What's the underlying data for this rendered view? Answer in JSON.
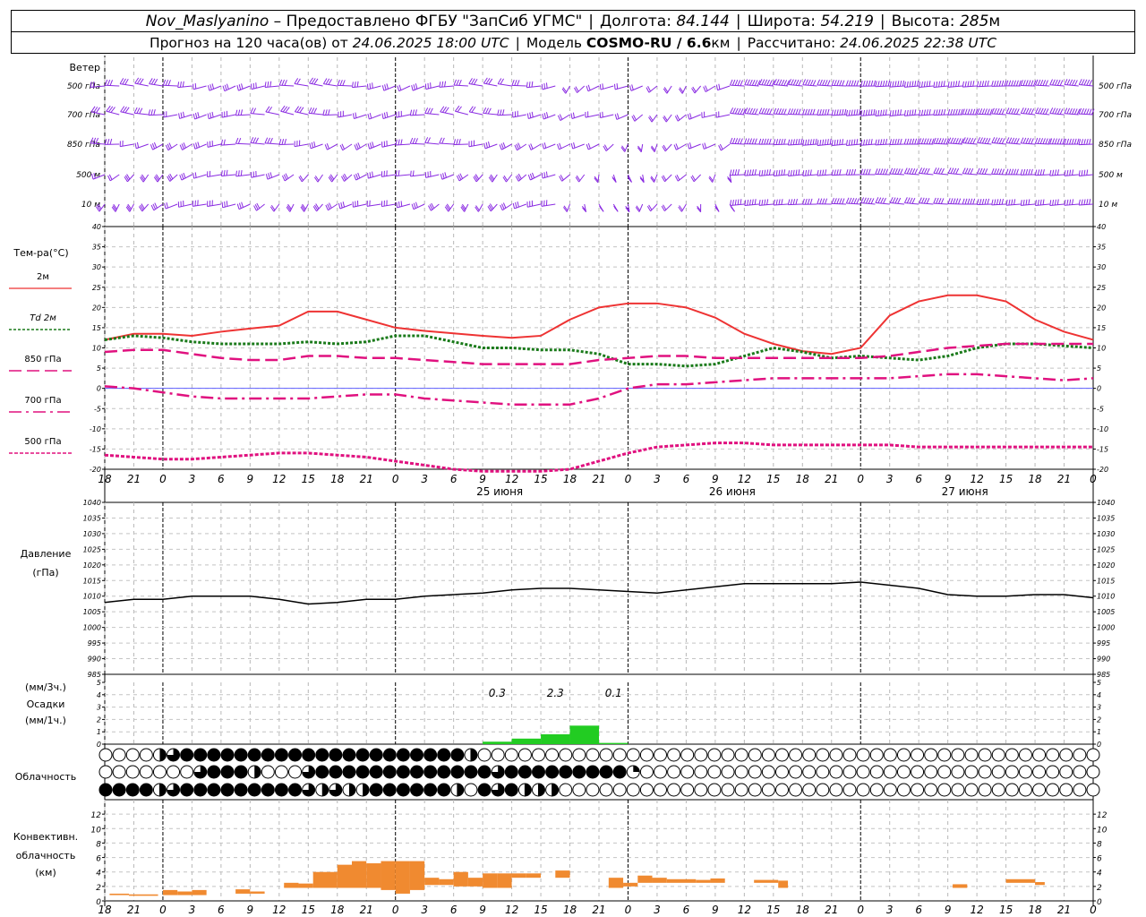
{
  "header": {
    "station": "Nov_Maslyanino",
    "provider": "– Предоставлено ФГБУ \"ЗапСиб УГМС\"",
    "sep": "|",
    "lon_label": "Долгота:",
    "lon_value": "84.144",
    "lat_label": "Широта:",
    "lat_value": "54.219",
    "alt_label": "Высота:",
    "alt_value": "285",
    "alt_unit": "м"
  },
  "subheader": {
    "forecast_label": "Прогноз на 120 часа(ов) от",
    "forecast_time": "24.06.2025 18:00 UTC",
    "model_label": "Модель",
    "model_name": "COSMO-RU / 6.6",
    "model_unit": "км",
    "calc_label": "Рассчитано:",
    "calc_time": "24.06.2025 22:38 UTC"
  },
  "colors": {
    "wind": "#8a2be2",
    "temp2m": "#ee3333",
    "td2m": "#1a7a1a",
    "t850": "#e0117f",
    "t700": "#e0117f",
    "t500": "#e0117f",
    "pressure": "#000000",
    "precip": "#22cc22",
    "conv": "#f08a30",
    "zero_line": "#6060ff"
  },
  "icons": {
    "wind": "wind-barb-icon",
    "cloud": "cloud-cover-circle-icon"
  },
  "time_axis": {
    "hour_labels": [
      "18",
      "21",
      "0",
      "3",
      "6",
      "9",
      "12",
      "15",
      "18",
      "21",
      "0",
      "3",
      "6",
      "9",
      "12",
      "15",
      "18",
      "21",
      "0",
      "3",
      "6",
      "9",
      "12",
      "15",
      "18",
      "21",
      "0",
      "3",
      "6",
      "9",
      "12",
      "15",
      "18",
      "21",
      "0"
    ],
    "date_labels": [
      {
        "label": "25 июня",
        "hour_index": 13
      },
      {
        "label": "26 июня",
        "hour_index": 21
      },
      {
        "label": "27 июня",
        "hour_index": 29
      }
    ]
  },
  "wind_panel": {
    "title": "Ветер",
    "levels": [
      "500 гПа",
      "700 гПа",
      "850 гПа",
      "500 м",
      "10  м"
    ]
  },
  "chart_data": [
    {
      "type": "line",
      "title": "Тем-ра(°С)",
      "ylim": [
        -20,
        40
      ],
      "yticks": [
        "40",
        "35",
        "30",
        "25",
        "20",
        "15",
        "10",
        "5",
        "0",
        "-5",
        "-10",
        "-15",
        "-20"
      ],
      "x_hours": [
        0,
        3,
        6,
        9,
        12,
        15,
        18,
        21,
        24,
        27,
        30,
        33,
        36,
        39,
        42,
        45,
        48,
        51,
        54,
        57,
        60,
        63,
        66,
        69,
        72,
        75,
        78,
        81,
        84,
        87,
        90,
        93,
        96,
        99,
        102
      ],
      "series": [
        {
          "name": "2м",
          "style": "solid",
          "values": [
            12,
            13.5,
            13.5,
            13,
            14,
            14.8,
            15.5,
            19,
            19,
            17,
            15,
            14.2,
            13.6,
            13,
            12.5,
            13,
            17,
            20,
            21,
            21,
            20,
            17.5,
            13.5,
            11,
            9.2,
            8.5,
            10,
            18,
            21.5,
            23,
            23,
            21.5,
            17,
            14,
            12
          ]
        },
        {
          "name": "Td 2м",
          "style": "dotted",
          "values": [
            12,
            13,
            12.5,
            11.5,
            11,
            11,
            11,
            11.5,
            11,
            11.5,
            13,
            13,
            11.5,
            10,
            10,
            9.5,
            9.5,
            8.5,
            6,
            6,
            5.5,
            6,
            8,
            10,
            9,
            7.5,
            8,
            7.5,
            7,
            8,
            10,
            11,
            11,
            10.5,
            10
          ]
        },
        {
          "name": "850 гПа",
          "style": "dash",
          "values": [
            9,
            9.5,
            9.5,
            8.5,
            7.5,
            7,
            7,
            8,
            8,
            7.5,
            7.5,
            7,
            6.5,
            6,
            6,
            6,
            6,
            7,
            7.5,
            8,
            8,
            7.5,
            7.5,
            7.5,
            7.5,
            7.5,
            7.5,
            8,
            9,
            10,
            10.5,
            11,
            11,
            11,
            11
          ]
        },
        {
          "name": "700 гПа",
          "style": "dashdot",
          "values": [
            0.5,
            0,
            -1,
            -2,
            -2.5,
            -2.5,
            -2.5,
            -2.5,
            -2,
            -1.5,
            -1.5,
            -2.5,
            -3,
            -3.5,
            -4,
            -4,
            -4,
            -2.5,
            0,
            1,
            1,
            1.5,
            2,
            2.5,
            2.5,
            2.5,
            2.5,
            2.5,
            3,
            3.5,
            3.5,
            3,
            2.5,
            2,
            2.5
          ]
        },
        {
          "name": "500 гПа",
          "style": "dashfine",
          "values": [
            -16.5,
            -17,
            -17.5,
            -17.5,
            -17,
            -16.5,
            -16,
            -16,
            -16.5,
            -17,
            -18,
            -19,
            -20,
            -20.5,
            -20.5,
            -20.5,
            -20,
            -18,
            -16,
            -14.5,
            -14,
            -13.5,
            -13.5,
            -14,
            -14,
            -14,
            -14,
            -14,
            -14.5,
            -14.5,
            -14.5,
            -14.5,
            -14.5,
            -14.5,
            -14.5
          ]
        }
      ]
    },
    {
      "type": "line",
      "title": "Давление",
      "ylabel": "(гПа)",
      "ylim": [
        985,
        1040
      ],
      "yticks": [
        "1040",
        "1035",
        "1030",
        "1025",
        "1020",
        "1015",
        "1010",
        "1005",
        "1000",
        "995",
        "990",
        "985"
      ],
      "x_hours": [
        0,
        3,
        6,
        9,
        12,
        15,
        18,
        21,
        24,
        27,
        30,
        33,
        36,
        39,
        42,
        45,
        48,
        51,
        54,
        57,
        60,
        63,
        66,
        69,
        72,
        75,
        78,
        81,
        84,
        87,
        90,
        93,
        96,
        99,
        102
      ],
      "values": [
        1008,
        1009,
        1009,
        1010,
        1010,
        1010,
        1009,
        1007.5,
        1008,
        1009,
        1009,
        1010,
        1010.5,
        1011,
        1012,
        1012.5,
        1012.5,
        1012,
        1011.5,
        1011,
        1012,
        1013,
        1014,
        1014,
        1014,
        1014,
        1014.5,
        1013.5,
        1012.5,
        1010.5,
        1010,
        1010,
        1010.5,
        1010.5,
        1009.5
      ]
    },
    {
      "type": "bar",
      "title": "Осадки",
      "ylabel": "(мм/3ч.)",
      "ylabel2": "(мм/1ч.)",
      "ylim": [
        0,
        5
      ],
      "yticks": [
        "5",
        "4",
        "3",
        "2",
        "1",
        "0"
      ],
      "bars": [
        {
          "start": 39,
          "end": 42,
          "value": 0.2
        },
        {
          "start": 42,
          "end": 45,
          "value": 0.45
        },
        {
          "start": 45,
          "end": 48,
          "value": 0.8
        },
        {
          "start": 48,
          "end": 51,
          "value": 1.5
        },
        {
          "start": 51,
          "end": 54,
          "value": 0.1
        }
      ],
      "annotations": [
        {
          "text": "0.3",
          "hour": 40.5
        },
        {
          "text": "2.3",
          "hour": 46.5
        },
        {
          "text": "0.1",
          "hour": 52.5
        }
      ]
    },
    {
      "type": "bar",
      "title": "Конвективн.",
      "ylabel": "облачность",
      "ylabel2": "(км)",
      "ylim": [
        0,
        14
      ],
      "yticks": [
        "12",
        "10",
        "8",
        "6",
        "4",
        "2",
        "0"
      ],
      "bars": [
        {
          "start": 0.5,
          "end": 2.5,
          "bottom": 0.8,
          "top": 1.0
        },
        {
          "start": 2.5,
          "end": 5.5,
          "bottom": 0.7,
          "top": 0.9
        },
        {
          "start": 6,
          "end": 7.5,
          "bottom": 0.8,
          "top": 1.5
        },
        {
          "start": 7.5,
          "end": 9,
          "bottom": 0.8,
          "top": 1.3
        },
        {
          "start": 9,
          "end": 10.5,
          "bottom": 0.8,
          "top": 1.5
        },
        {
          "start": 13.5,
          "end": 15,
          "bottom": 1.0,
          "top": 1.6
        },
        {
          "start": 15,
          "end": 16.5,
          "bottom": 1.0,
          "top": 1.3
        },
        {
          "start": 18.5,
          "end": 20,
          "bottom": 1.8,
          "top": 2.5
        },
        {
          "start": 20,
          "end": 21.5,
          "bottom": 1.8,
          "top": 2.4
        },
        {
          "start": 21.5,
          "end": 24,
          "bottom": 1.8,
          "top": 4.0
        },
        {
          "start": 24,
          "end": 25.5,
          "bottom": 1.8,
          "top": 5.0
        },
        {
          "start": 25.5,
          "end": 27,
          "bottom": 1.8,
          "top": 5.5
        },
        {
          "start": 27,
          "end": 28.5,
          "bottom": 1.8,
          "top": 5.2
        },
        {
          "start": 28.5,
          "end": 30,
          "bottom": 1.5,
          "top": 5.5
        },
        {
          "start": 30,
          "end": 31.5,
          "bottom": 1.0,
          "top": 5.5
        },
        {
          "start": 31.5,
          "end": 33,
          "bottom": 1.5,
          "top": 5.5
        },
        {
          "start": 33,
          "end": 34.5,
          "bottom": 2.2,
          "top": 3.2
        },
        {
          "start": 34.5,
          "end": 36,
          "bottom": 2.2,
          "top": 3.0
        },
        {
          "start": 36,
          "end": 37.5,
          "bottom": 2.0,
          "top": 4.0
        },
        {
          "start": 37.5,
          "end": 39,
          "bottom": 2.0,
          "top": 3.2
        },
        {
          "start": 39,
          "end": 40.5,
          "bottom": 1.8,
          "top": 3.8
        },
        {
          "start": 40.5,
          "end": 42,
          "bottom": 1.8,
          "top": 3.8
        },
        {
          "start": 42,
          "end": 43.5,
          "bottom": 3.2,
          "top": 3.8
        },
        {
          "start": 43.5,
          "end": 45,
          "bottom": 3.2,
          "top": 3.8
        },
        {
          "start": 46.5,
          "end": 48,
          "bottom": 3.2,
          "top": 4.2
        },
        {
          "start": 52,
          "end": 53.5,
          "bottom": 1.8,
          "top": 3.2
        },
        {
          "start": 53.5,
          "end": 55,
          "bottom": 2.0,
          "top": 2.5
        },
        {
          "start": 55,
          "end": 56.5,
          "bottom": 2.5,
          "top": 3.5
        },
        {
          "start": 56.5,
          "end": 58,
          "bottom": 2.5,
          "top": 3.2
        },
        {
          "start": 58,
          "end": 59.5,
          "bottom": 2.5,
          "top": 3.0
        },
        {
          "start": 59.5,
          "end": 61,
          "bottom": 2.5,
          "top": 3.0
        },
        {
          "start": 61,
          "end": 62.5,
          "bottom": 2.5,
          "top": 2.9
        },
        {
          "start": 62.5,
          "end": 64,
          "bottom": 2.5,
          "top": 3.1
        },
        {
          "start": 67,
          "end": 69.5,
          "bottom": 2.5,
          "top": 2.9
        },
        {
          "start": 69.5,
          "end": 70.5,
          "bottom": 1.8,
          "top": 2.8
        },
        {
          "start": 87.5,
          "end": 89,
          "bottom": 1.8,
          "top": 2.3
        },
        {
          "start": 93,
          "end": 96,
          "bottom": 2.5,
          "top": 3.0
        },
        {
          "start": 96,
          "end": 97,
          "bottom": 2.2,
          "top": 2.6
        }
      ]
    }
  ],
  "cloud_panel": {
    "title": "Облачность",
    "rows": [
      "0000345555555555555555555552000000000000000000000000000000000000000000000000000000000000000000000000000000000000000000000000003030455225434353000",
      "000000045553000455555555555554555555555100000000000000000000000000000000000000000000000000000000000000000000000000000000000000000300000202000000",
      "555524555555555434335555552054522200000000000000000000000000000000000000000000000000000000000000000000000000000000000000000000000000000000000000"
    ]
  }
}
